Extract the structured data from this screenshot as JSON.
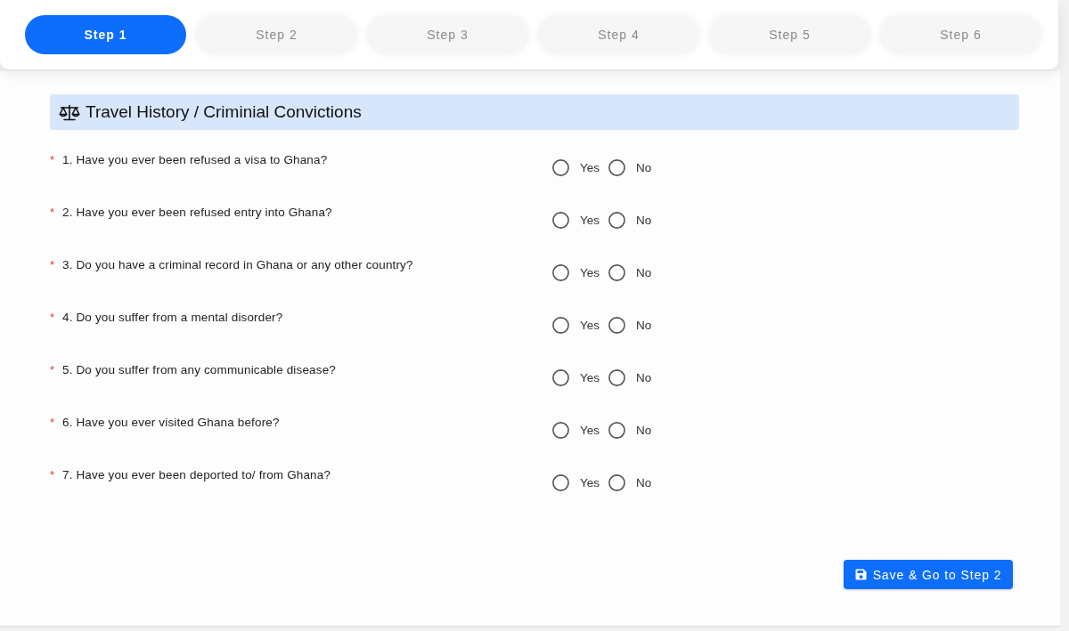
{
  "steps": [
    {
      "label": "Step 1",
      "selected": true
    },
    {
      "label": "Step 2",
      "selected": false
    },
    {
      "label": "Step 3",
      "selected": false
    },
    {
      "label": "Step 4",
      "selected": false
    },
    {
      "label": "Step 5",
      "selected": false
    },
    {
      "label": "Step 6",
      "selected": false
    }
  ],
  "section": {
    "title": "Travel History / Criminial Convictions"
  },
  "questions": [
    {
      "required_mark": "*",
      "text": "1. Have you ever been refused a visa to Ghana?",
      "options": [
        {
          "label": "Yes",
          "selected": false
        },
        {
          "label": "No",
          "selected": false
        }
      ]
    },
    {
      "required_mark": "*",
      "text": "2. Have you ever been refused entry into Ghana?",
      "options": [
        {
          "label": "Yes",
          "selected": false
        },
        {
          "label": "No",
          "selected": false
        }
      ]
    },
    {
      "required_mark": "*",
      "text": "3. Do you have a criminal record in Ghana or any other country?",
      "options": [
        {
          "label": "Yes",
          "selected": false
        },
        {
          "label": "No",
          "selected": false
        }
      ]
    },
    {
      "required_mark": "*",
      "text": "4. Do you suffer from a mental disorder?",
      "options": [
        {
          "label": "Yes",
          "selected": false
        },
        {
          "label": "No",
          "selected": false
        }
      ]
    },
    {
      "required_mark": "*",
      "text": "5. Do you suffer from any communicable disease?",
      "options": [
        {
          "label": "Yes",
          "selected": false
        },
        {
          "label": "No",
          "selected": false
        }
      ]
    },
    {
      "required_mark": "*",
      "text": "6. Have you ever visited Ghana before?",
      "options": [
        {
          "label": "Yes",
          "selected": false
        },
        {
          "label": "No",
          "selected": false
        }
      ]
    },
    {
      "required_mark": "*",
      "text": "7. Have you ever been deported to/ from Ghana?",
      "options": [
        {
          "label": "Yes",
          "selected": false
        },
        {
          "label": "No",
          "selected": false
        }
      ]
    }
  ],
  "submit_button": {
    "label": "Save & Go to Step 2"
  }
}
